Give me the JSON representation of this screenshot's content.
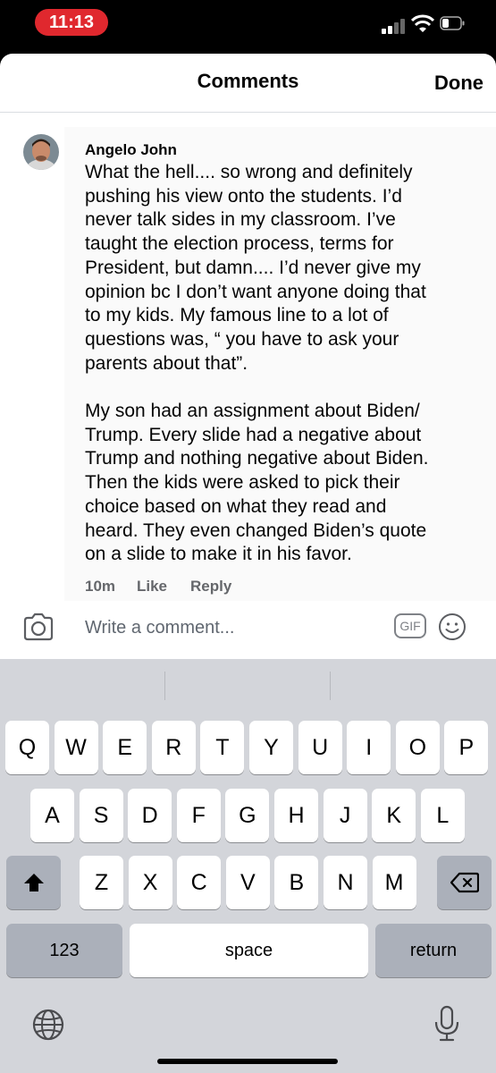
{
  "status_bar": {
    "time": "11:13"
  },
  "header": {
    "title": "Comments",
    "done_label": "Done"
  },
  "comment": {
    "author": "Angelo John",
    "text": "What the hell.... so wrong and definitely\npushing his view onto the students. I’d\nnever talk sides in my classroom. I’ve\ntaught the election process, terms for\nPresident, but damn.... I’d never give my\nopinion bc I don’t want anyone doing that\nto my kids. My famous line to a lot of\nquestions was, “ you have to ask your\nparents about that”.\n\nMy son had an assignment about Biden/\nTrump. Every slide had a negative about\nTrump and nothing negative about Biden.\nThen the kids were asked to pick their\nchoice based on what they read and\nheard. They even changed Biden’s quote\non a slide to make it in his favor.",
    "time": "10m",
    "like_label": "Like",
    "reply_label": "Reply"
  },
  "composer": {
    "placeholder": "Write a comment...",
    "gif_label": "GIF",
    "icons": [
      "camera-icon",
      "gif-icon",
      "smiley-icon"
    ]
  },
  "keyboard": {
    "row1": [
      "Q",
      "W",
      "E",
      "R",
      "T",
      "Y",
      "U",
      "I",
      "O",
      "P"
    ],
    "row2": [
      "A",
      "S",
      "D",
      "F",
      "G",
      "H",
      "J",
      "K",
      "L"
    ],
    "row3": [
      "Z",
      "X",
      "C",
      "V",
      "B",
      "N",
      "M"
    ],
    "numbers_label": "123",
    "space_label": "space",
    "return_label": "return",
    "icons": [
      "shift-icon",
      "delete-icon",
      "globe-icon",
      "microphone-icon"
    ]
  },
  "colors": {
    "time_pill": "#e0282e",
    "keyboard_bg": "#d3d5da",
    "secondary_text": "#65676b"
  }
}
